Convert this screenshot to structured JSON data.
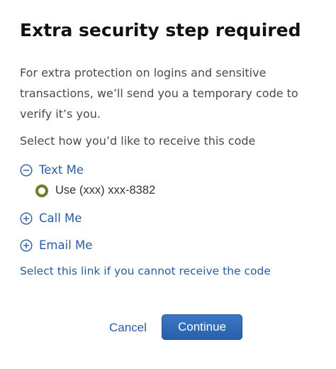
{
  "header": {
    "title": "Extra security step required"
  },
  "intro": {
    "text": "For extra protection on logins and sensitive transactions, we’ll send you a temporary code to verify it’s you."
  },
  "prompt": {
    "text": "Select how you’d like to receive this code"
  },
  "methods": [
    {
      "label": "Text Me",
      "expanded": true,
      "icon": "minus-circle-icon",
      "options": [
        {
          "label": "Use (xxx) xxx-8382",
          "selected": true
        }
      ]
    },
    {
      "label": "Call Me",
      "expanded": false,
      "icon": "plus-circle-icon"
    },
    {
      "label": "Email Me",
      "expanded": false,
      "icon": "plus-circle-icon"
    }
  ],
  "help_link": {
    "label": "Select this link if you cannot receive the code"
  },
  "actions": {
    "cancel_label": "Cancel",
    "continue_label": "Continue"
  },
  "colors": {
    "link": "#2a5d9f",
    "radio": "#6f7d2a",
    "primary_button": "#2f6bb8"
  }
}
